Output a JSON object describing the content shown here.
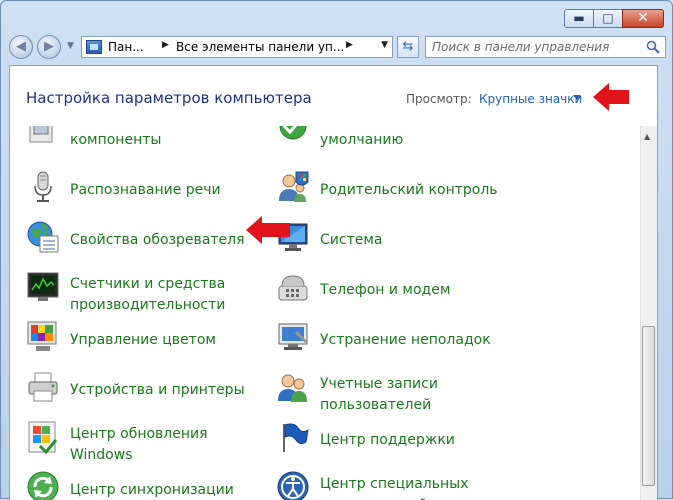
{
  "window": {
    "minimize_glyph": "▬",
    "maximize_glyph": "□",
    "close_glyph": "✕"
  },
  "nav": {
    "back_glyph": "◀",
    "forward_glyph": "▶",
    "recent_glyph": "▼",
    "breadcrumb": [
      "Пан...",
      "Все элементы панели уп..."
    ],
    "crumb_sep_glyph": "▶",
    "address_dropdown_glyph": "▼",
    "refresh_glyph": "⇆",
    "search_placeholder": "Поиск в панели управления"
  },
  "header": {
    "title": "Настройка параметров компьютера",
    "view_label": "Просмотр:",
    "view_value": "Крупные значки"
  },
  "items_left": [
    {
      "label": "компоненты",
      "icon": "programs-features-icon"
    },
    {
      "label": "Распознавание речи",
      "icon": "microphone-icon"
    },
    {
      "label": "Свойства обозревателя",
      "icon": "internet-options-icon"
    },
    {
      "label": "Счетчики и средства\nпроизводительности",
      "icon": "performance-icon"
    },
    {
      "label": "Управление цветом",
      "icon": "color-management-icon"
    },
    {
      "label": "Устройства и принтеры",
      "icon": "printer-icon"
    },
    {
      "label": "Центр обновления\nWindows",
      "icon": "windows-update-icon"
    },
    {
      "label": "Центр синхронизации",
      "icon": "sync-center-icon"
    }
  ],
  "items_right": [
    {
      "label": "умолчанию",
      "icon": "default-programs-icon"
    },
    {
      "label": "Родительский контроль",
      "icon": "parental-controls-icon"
    },
    {
      "label": "Система",
      "icon": "system-icon"
    },
    {
      "label": "Телефон и модем",
      "icon": "phone-modem-icon"
    },
    {
      "label": "Устранение неполадок",
      "icon": "troubleshooting-icon"
    },
    {
      "label": "Учетные записи\nпользователей",
      "icon": "user-accounts-icon"
    },
    {
      "label": "Центр поддержки",
      "icon": "action-center-icon"
    },
    {
      "label": "Центр специальных\nвозможностей",
      "icon": "ease-of-access-icon"
    }
  ],
  "colors": {
    "item_text": "#1b7a1b",
    "heading": "#1e3287",
    "link": "#1f5fb6",
    "annotation_arrow": "#e0141a"
  }
}
